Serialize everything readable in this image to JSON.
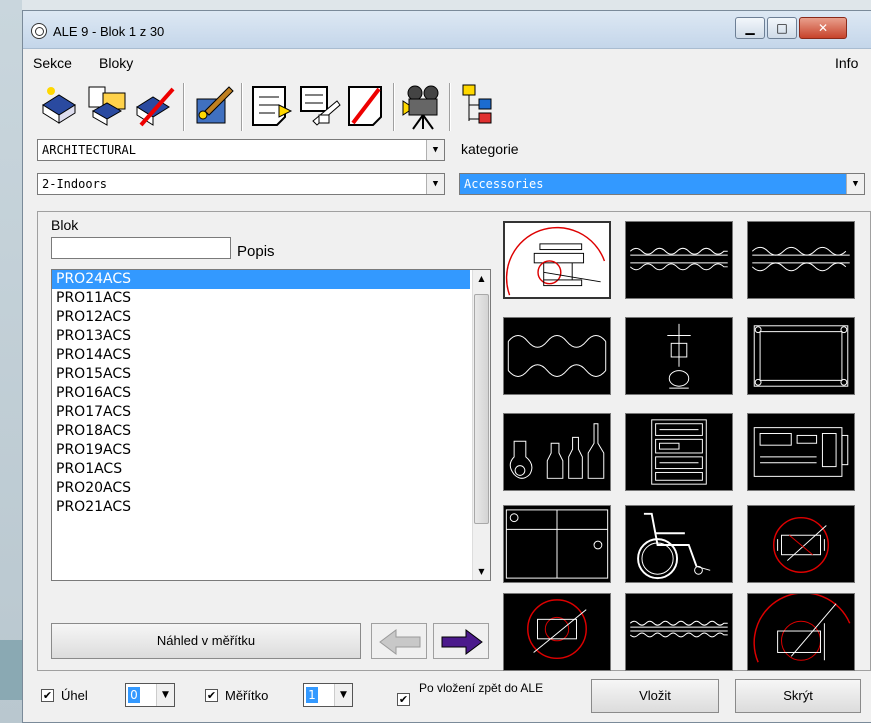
{
  "window": {
    "title": "ALE 9 - Blok 1 z 30",
    "btn_min": "▁",
    "btn_max": "□",
    "btn_close": "✕"
  },
  "menu": {
    "sekce": "Sekce",
    "bloky": "Bloky",
    "info": "Info"
  },
  "filters": {
    "library": "ARCHITECTURAL",
    "subset": "2-Indoors",
    "kategorie_label": "kategorie",
    "kategorie_value": "Accessories"
  },
  "block": {
    "blok_label": "Blok",
    "blok_value": "",
    "popis_label": "Popis"
  },
  "list": {
    "items": [
      "PRO24ACS",
      "PRO11ACS",
      "PRO12ACS",
      "PRO13ACS",
      "PRO14ACS",
      "PRO15ACS",
      "PRO16ACS",
      "PRO17ACS",
      "PRO18ACS",
      "PRO19ACS",
      "PRO1ACS",
      "PRO20ACS",
      "PRO21ACS"
    ],
    "selected_index": 0
  },
  "buttons": {
    "nahled": "Náhled v měřítku",
    "vlozit": "Vložit",
    "skryt": "Skrýt"
  },
  "options": {
    "uhel_label": "Úhel",
    "uhel_value": "0",
    "meritko_label": "Měřítko",
    "meritko_value": "1",
    "po_vlozeni_label": "Po vložení zpět do ALE",
    "check_mark": "✔"
  },
  "colors": {
    "selection": "#3399ff",
    "arrow_right": "#4b1a8c"
  },
  "icons": [
    "book-add-icon",
    "book-open-icon",
    "book-delete-icon",
    "paint-icon",
    "sheet-icon",
    "sheet-edit-icon",
    "sheet-delete-icon",
    "camera-icon",
    "tree-icon"
  ]
}
